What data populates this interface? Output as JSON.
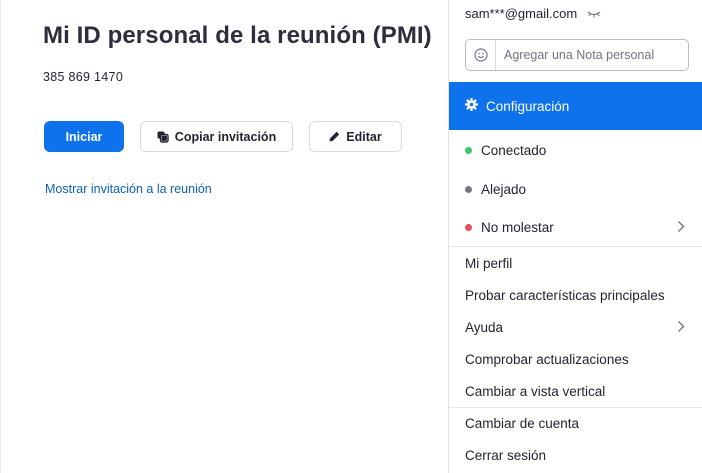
{
  "main": {
    "title": "Mi ID personal de la reunión (PMI)",
    "meeting_id": "385 869 1470",
    "start_label": "Iniciar",
    "copy_label": "Copiar invitación",
    "edit_label": "Editar",
    "show_invite_link": "Mostrar invitación a la reunión"
  },
  "menu": {
    "email": "sam***@gmail.com",
    "note_placeholder": "Agregar una Nota personal",
    "settings_label": "Configuración",
    "status": [
      {
        "label": "Conectado",
        "color": "#3cc36b"
      },
      {
        "label": "Alejado",
        "color": "#747487"
      },
      {
        "label": "No molestar",
        "color": "#e8505b"
      }
    ],
    "items": [
      {
        "label": "Mi perfil"
      },
      {
        "label": "Probar características principales"
      },
      {
        "label": "Ayuda"
      },
      {
        "label": "Comprobar actualizaciones"
      },
      {
        "label": "Cambiar a vista vertical"
      },
      {
        "label": "Cambiar de cuenta"
      },
      {
        "label": "Cerrar sesión"
      }
    ]
  },
  "colors": {
    "accent": "#0e72ed",
    "link": "#0e5fb5"
  }
}
